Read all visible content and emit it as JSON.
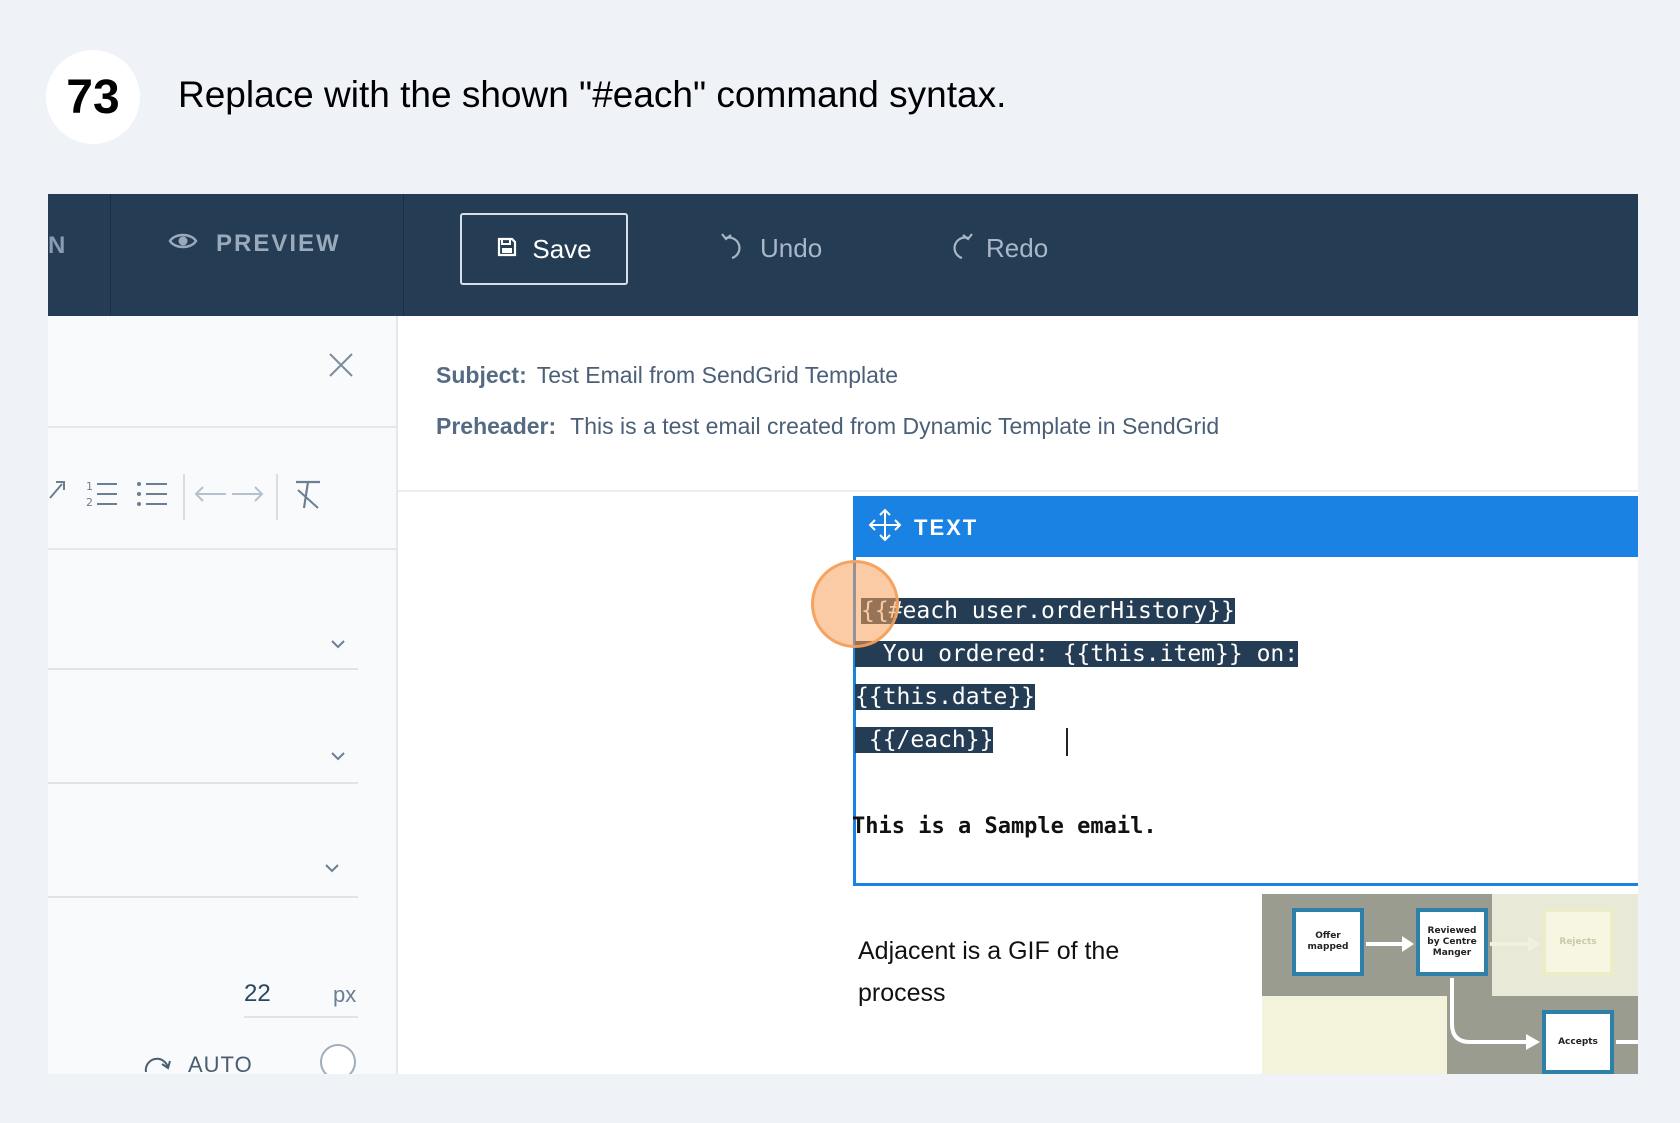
{
  "step": {
    "number": "73",
    "instruction": "Replace with the shown \"#each\" command syntax."
  },
  "topbar": {
    "cut_label": "N",
    "preview_label": "PREVIEW",
    "save_label": "Save",
    "undo_label": "Undo",
    "redo_label": "Redo"
  },
  "left_panel": {
    "size_value": "22",
    "size_unit": "px",
    "auto_label": "AUTO"
  },
  "email_meta": {
    "subject_label": "Subject:",
    "subject_value": "Test Email from SendGrid Template",
    "preheader_label": "Preheader:",
    "preheader_value": "This is a test email created from Dynamic Template in SendGrid"
  },
  "text_module": {
    "header_label": "TEXT",
    "code_lines": [
      "{{#each user.orderHistory}}",
      "  You ordered: {{this.item}} on:",
      "{{this.date}}",
      " {{/each}}"
    ],
    "sample_text": "This is a Sample email."
  },
  "gif_caption": "Adjacent is a GIF of the process",
  "gif_boxes": [
    "Offer mapped",
    "Reviewed by Centre Manger",
    "Rejects",
    "Accepts"
  ],
  "colors": {
    "topbar": "#243c54",
    "accent_blue": "#1a82e2",
    "selection": "#243c54",
    "click_indicator": "#f5a05a"
  }
}
